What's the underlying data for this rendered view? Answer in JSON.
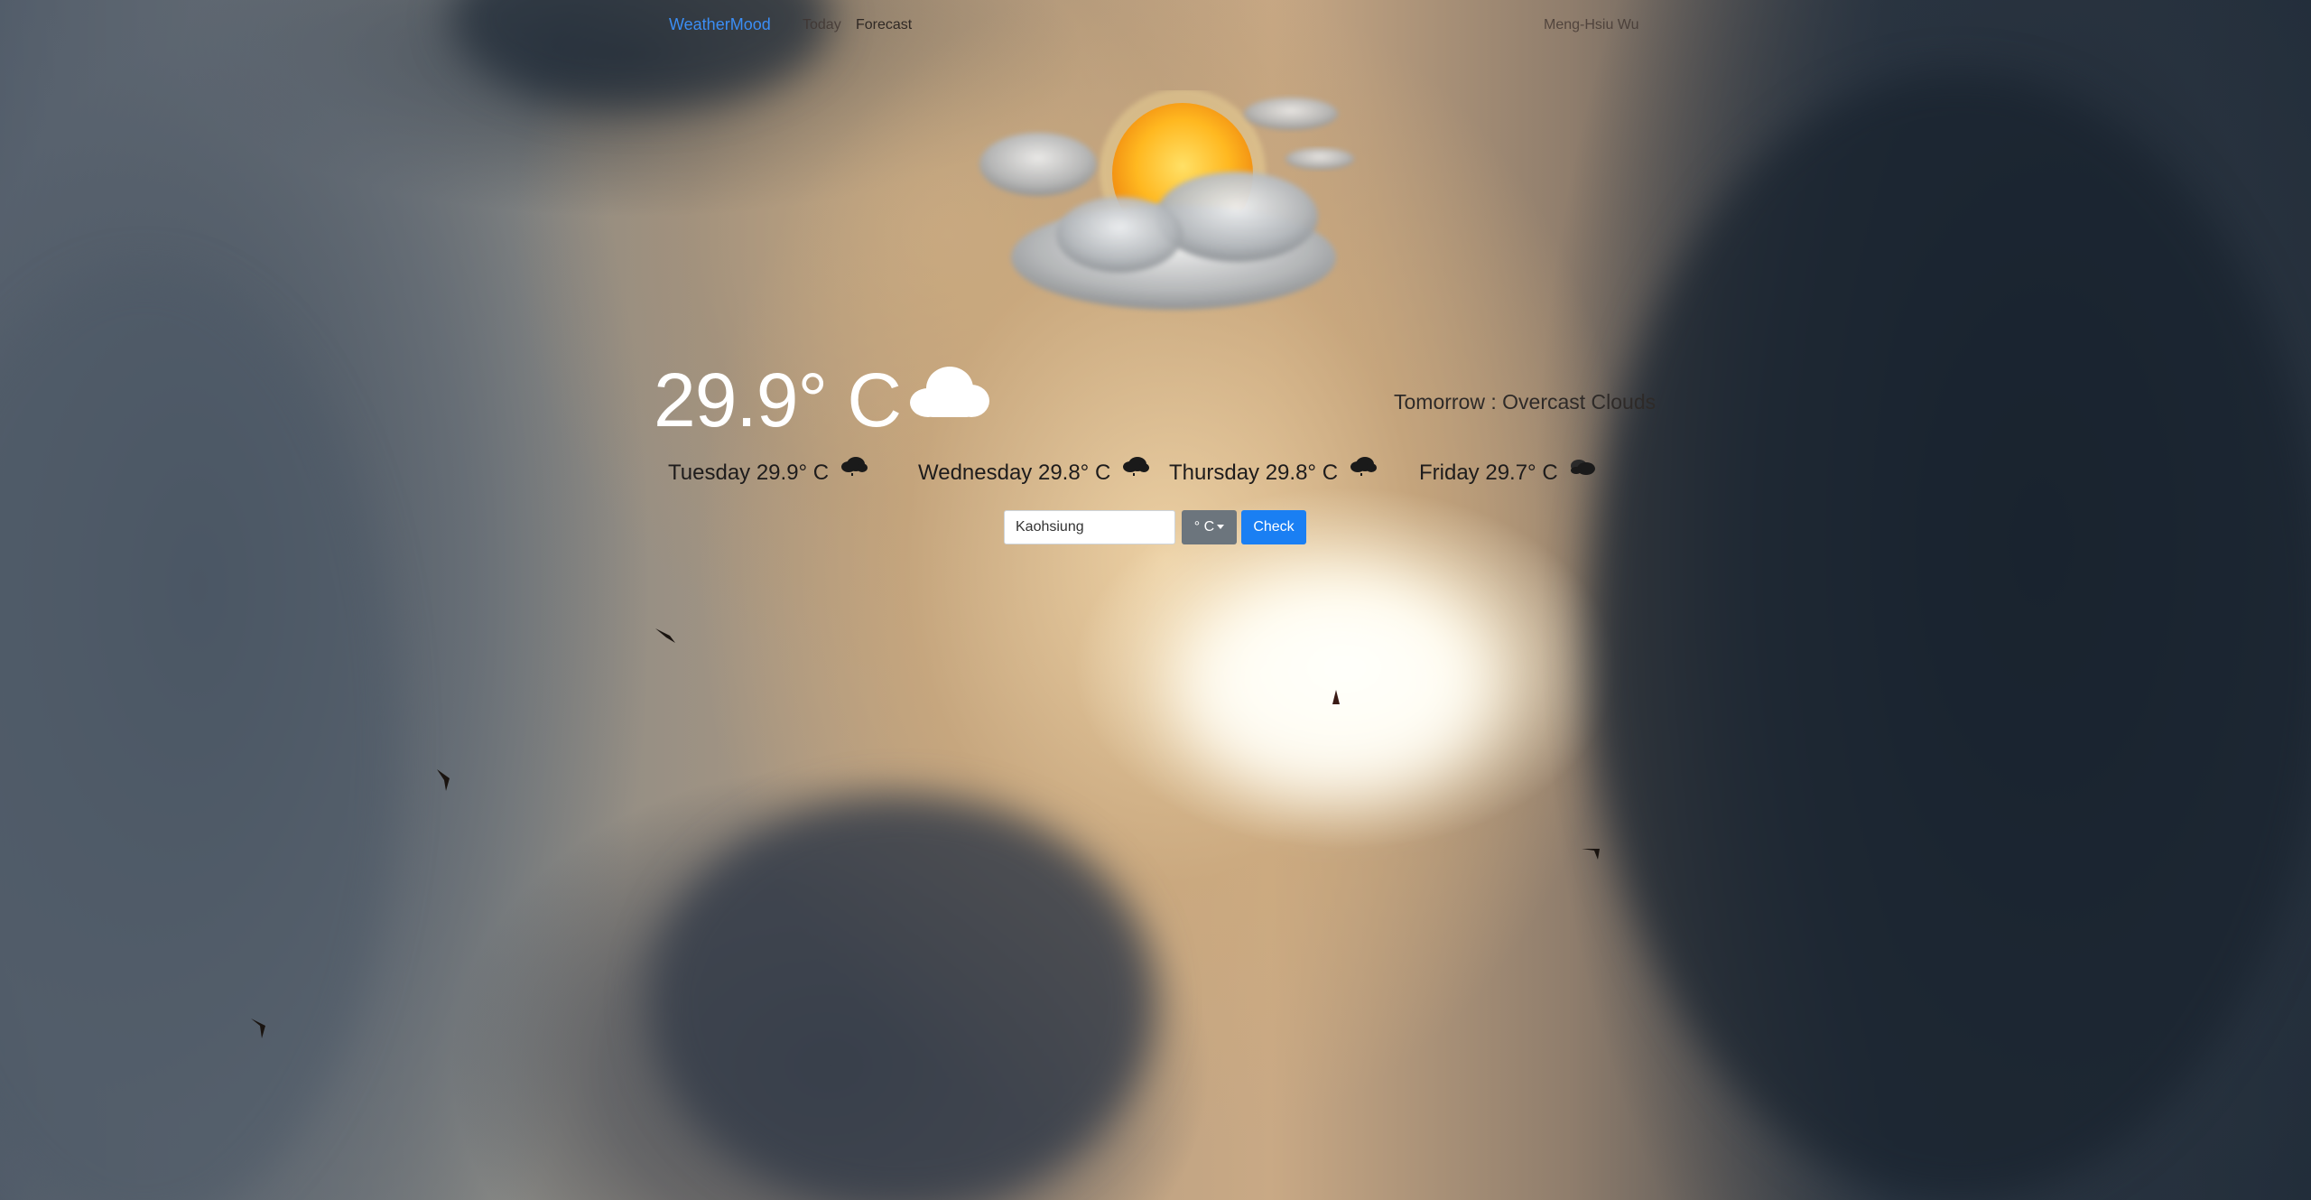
{
  "navbar": {
    "brand": "WeatherMood",
    "links": [
      {
        "label": "Today"
      },
      {
        "label": "Forecast"
      }
    ],
    "user": "Meng-Hsiu Wu"
  },
  "current": {
    "temperature": "29.9° C",
    "icon": "cloud-icon",
    "hero_icon": "partly-sunny-icon"
  },
  "tomorrow": {
    "text": "Tomorrow : Overcast Clouds"
  },
  "forecast": [
    {
      "label": "Tuesday 29.9° C",
      "icon": "rain-cloud-icon"
    },
    {
      "label": "Wednesday 29.8° C",
      "icon": "rain-cloud-icon"
    },
    {
      "label": "Thursday 29.8° C",
      "icon": "rain-cloud-icon"
    },
    {
      "label": "Friday 29.7° C",
      "icon": "overcast-cloud-icon"
    }
  ],
  "search": {
    "city_value": "Kaohsiung",
    "unit_label": "° C",
    "check_label": "Check"
  },
  "colors": {
    "brand": "#3b8ef5",
    "check_button": "#1a7ff3",
    "unit_button": "#6c757d"
  }
}
